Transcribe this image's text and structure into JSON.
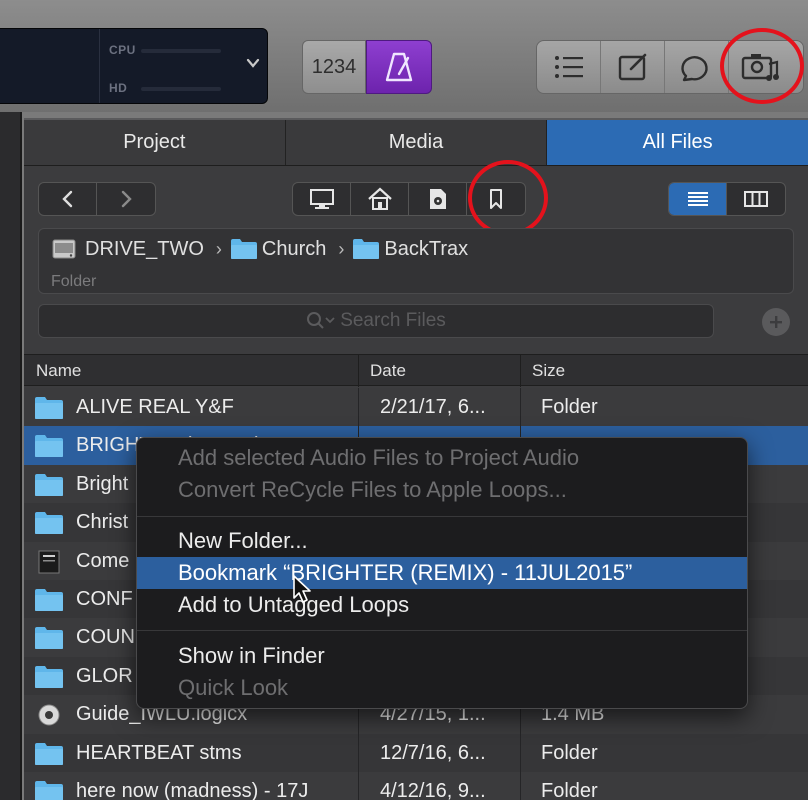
{
  "lcd": {
    "cpu_label": "CPU",
    "hd_label": "HD"
  },
  "toolbar": {
    "count_in_label": "1234"
  },
  "tabs": [
    {
      "label": "Project",
      "active": false
    },
    {
      "label": "Media",
      "active": false
    },
    {
      "label": "All Files",
      "active": true
    }
  ],
  "path": {
    "drive": "DRIVE_TWO",
    "folders": [
      "Church",
      "BackTrax"
    ],
    "separator": "›",
    "kind": "Folder"
  },
  "search": {
    "placeholder": "Search Files"
  },
  "columns": {
    "name": "Name",
    "date": "Date",
    "size": "Size"
  },
  "files": [
    {
      "name": "ALIVE REAL Y&F",
      "date": "2/21/17, 6...",
      "size": "Folder",
      "icon": "folder",
      "selected": false
    },
    {
      "name": "BRIGHTER (REMIX) - 11JUL2015",
      "date": "",
      "size": "",
      "icon": "folder",
      "selected": true
    },
    {
      "name": "Bright",
      "date": "",
      "size": "",
      "icon": "folder",
      "selected": false
    },
    {
      "name": "Christ",
      "date": "",
      "size": "",
      "icon": "folder",
      "selected": false
    },
    {
      "name": "Come",
      "date": "",
      "size": "",
      "icon": "doc",
      "selected": false
    },
    {
      "name": "CONF",
      "date": "",
      "size": "",
      "icon": "folder",
      "selected": false
    },
    {
      "name": "COUN",
      "date": "",
      "size": "",
      "icon": "folder",
      "selected": false
    },
    {
      "name": "GLOR",
      "date": "",
      "size": "",
      "icon": "folder",
      "selected": false
    },
    {
      "name": "Guide_IWLU.logicx",
      "date": "4/27/15, 1...",
      "size": "1.4 MB",
      "icon": "logic",
      "selected": false
    },
    {
      "name": "HEARTBEAT stms",
      "date": "12/7/16, 6...",
      "size": "Folder",
      "icon": "folder",
      "selected": false
    },
    {
      "name": "here now (madness) - 17J",
      "date": "4/12/16, 9...",
      "size": "Folder",
      "icon": "folder",
      "selected": false
    }
  ],
  "context_menu": {
    "add_audio": "Add selected Audio Files to Project Audio",
    "convert_recycle": "Convert ReCycle Files to Apple Loops...",
    "new_folder": "New Folder...",
    "bookmark": "Bookmark “BRIGHTER (REMIX) - 11JUL2015”",
    "add_untagged": "Add to Untagged Loops",
    "show_finder": "Show in Finder",
    "quick_look": "Quick Look"
  },
  "colors": {
    "accent_blue": "#2c6bb4",
    "highlight_blue": "#2c5f9e",
    "folder_blue": "#5fb6ea",
    "metronome_purple": "#7a2fc0",
    "annotation_red": "#e4121c"
  }
}
